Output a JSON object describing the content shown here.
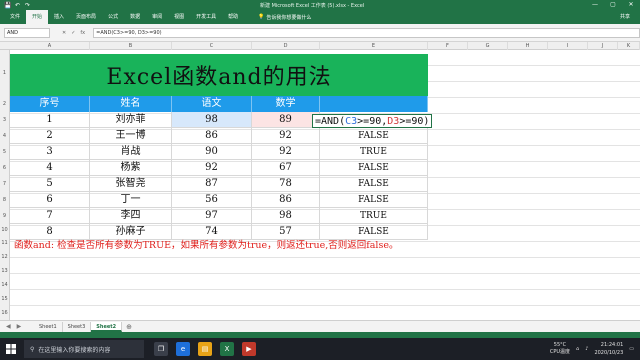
{
  "window": {
    "title": "新建 Microsoft Excel 工作表 (5).xlsx - Excel",
    "controls": [
      "—",
      "▢",
      "✕"
    ]
  },
  "quick_access": [
    "💾",
    "↶",
    "↷"
  ],
  "ribbon": {
    "tabs": [
      "文件",
      "开始",
      "插入",
      "页面布局",
      "公式",
      "数据",
      "审阅",
      "视图",
      "开发工具",
      "帮助"
    ],
    "selected_tab": "开始",
    "tell_me": "告诉我你想要做什么",
    "share": "共享"
  },
  "formula_bar": {
    "name_box": "AND",
    "cancel": "✕",
    "enter": "✓",
    "fx": "fx",
    "formula": "=AND(C3>=90, D3>=90)"
  },
  "columns": [
    "A",
    "B",
    "C",
    "D",
    "E",
    "F",
    "G",
    "H",
    "I",
    "J",
    "K"
  ],
  "rows": [
    "1",
    "2",
    "3",
    "4",
    "5",
    "6",
    "7",
    "8",
    "9",
    "10",
    "11",
    "12",
    "13",
    "14",
    "15",
    "16"
  ],
  "banner": "Excel函数and的用法",
  "table": {
    "headers": [
      "序号",
      "姓名",
      "语文",
      "数学",
      ""
    ],
    "rows": [
      {
        "no": "1",
        "name": "刘亦菲",
        "chinese": "98",
        "math": "89",
        "result": ""
      },
      {
        "no": "2",
        "name": "王一博",
        "chinese": "86",
        "math": "92",
        "result": "FALSE"
      },
      {
        "no": "3",
        "name": "肖战",
        "chinese": "90",
        "math": "92",
        "result": "TRUE"
      },
      {
        "no": "4",
        "name": "杨紫",
        "chinese": "92",
        "math": "67",
        "result": "FALSE"
      },
      {
        "no": "5",
        "name": "张智尧",
        "chinese": "87",
        "math": "78",
        "result": "FALSE"
      },
      {
        "no": "6",
        "name": "丁一",
        "chinese": "56",
        "math": "86",
        "result": "FALSE"
      },
      {
        "no": "7",
        "name": "李四",
        "chinese": "97",
        "math": "98",
        "result": "TRUE"
      },
      {
        "no": "8",
        "name": "孙麻子",
        "chinese": "74",
        "math": "57",
        "result": "FALSE"
      }
    ]
  },
  "edit_formula": {
    "prefix": "=AND(",
    "ref1": "C3",
    "mid": ">=90,",
    "ref2": "D3",
    "suffix": ">=90)"
  },
  "note": "函数and: 检查是否所有参数为TRUE，如果所有参数为true，则返还true,否则返回false。",
  "sheets": [
    "Sheet1",
    "Sheet3",
    "Sheet2"
  ],
  "active_sheet": "Sheet2",
  "taskbar": {
    "search_placeholder": "在这里输入你要搜索的内容",
    "weather_temp": "55°C",
    "weather_label": "CPU温度",
    "time": "21:24:01",
    "date": "2020/10/23"
  },
  "colors": {
    "excel_green": "#217346",
    "banner_green": "#19b35a",
    "header_blue": "#1f9bea",
    "note_red": "#e0201c"
  }
}
